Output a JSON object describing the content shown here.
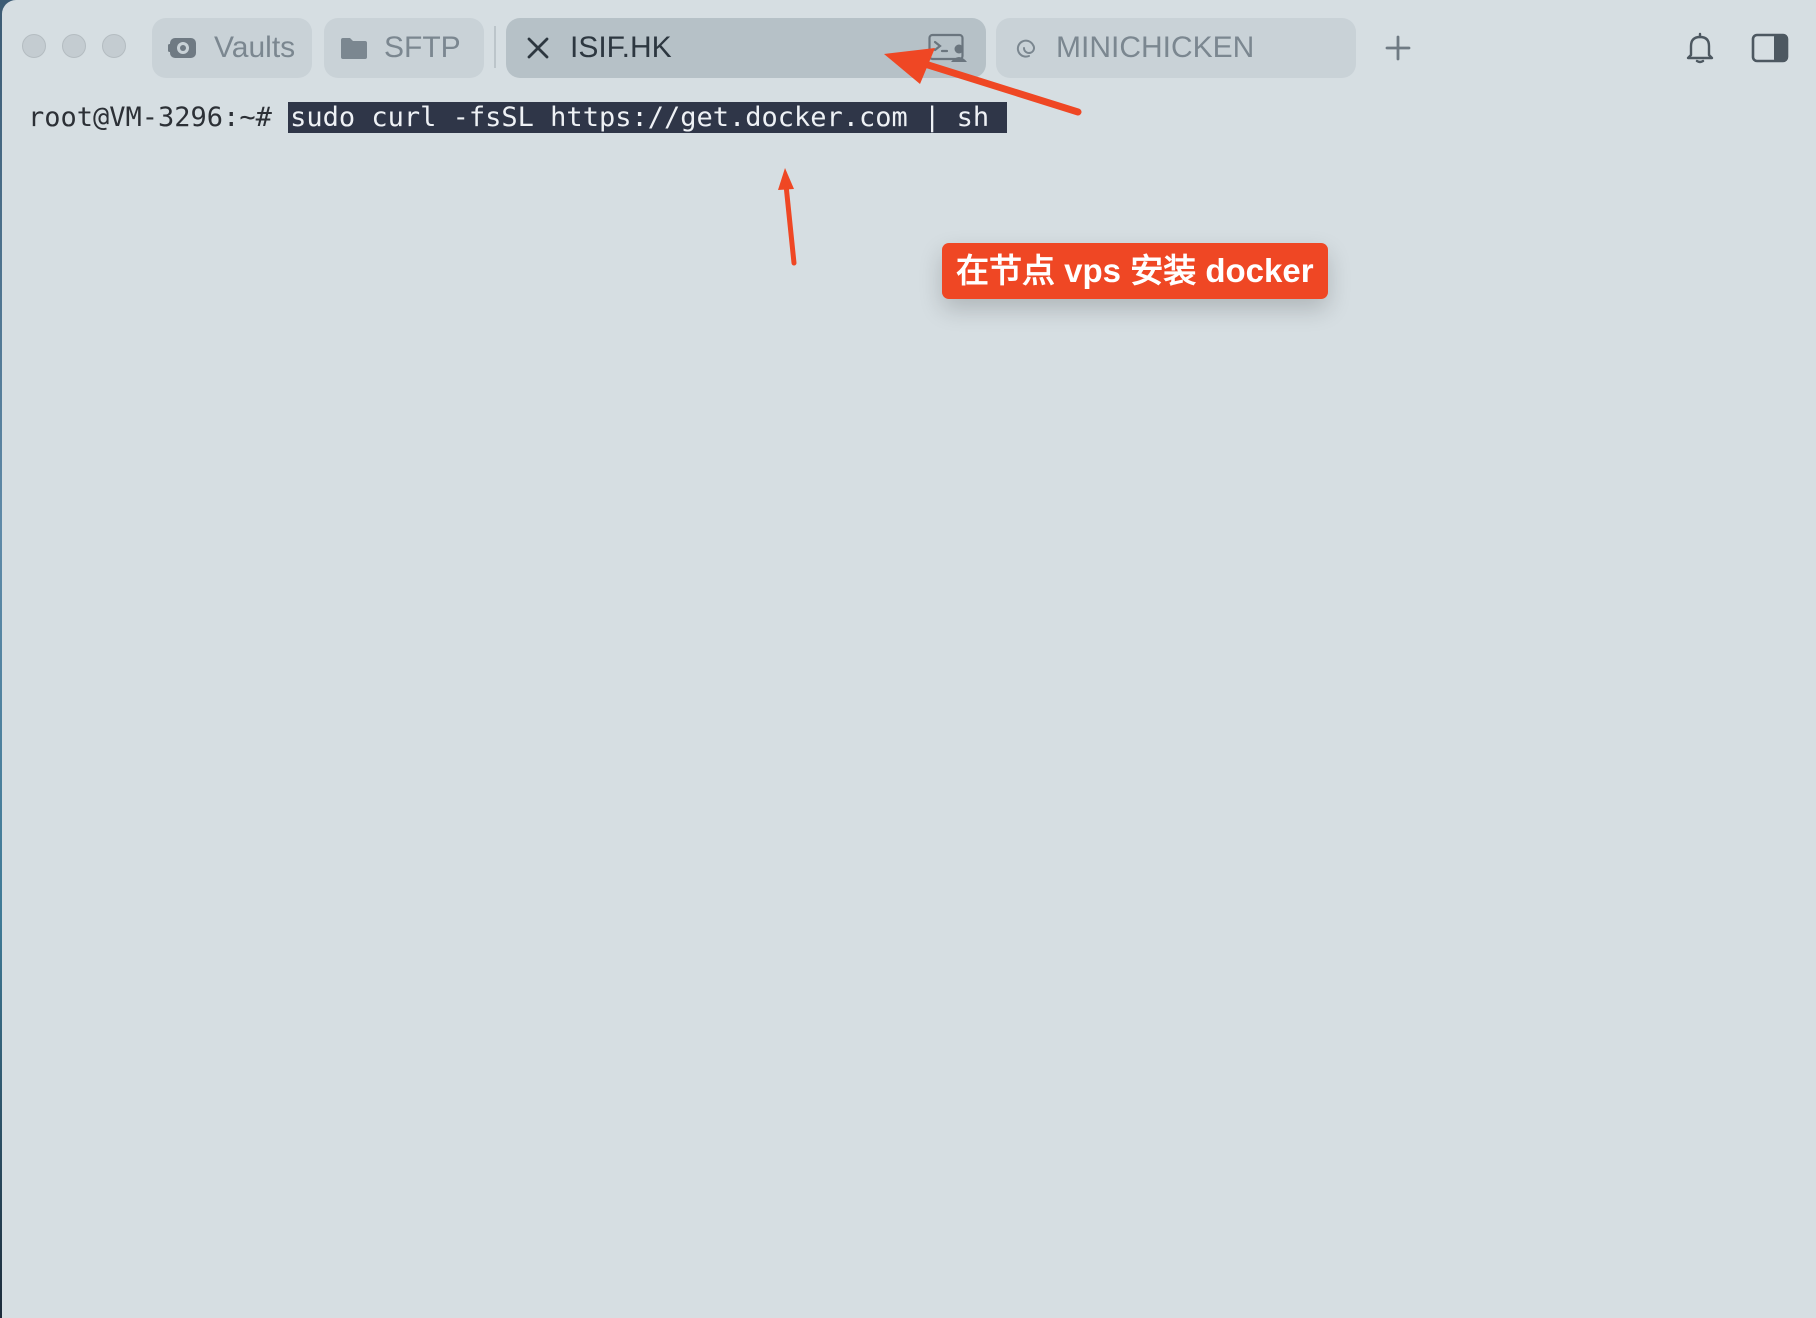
{
  "tabs": [
    {
      "label": "Vaults",
      "icon": "vault-icon"
    },
    {
      "label": "SFTP",
      "icon": "folder-icon"
    },
    {
      "label": "ISIF.HK",
      "icon": "close-icon",
      "active": true,
      "trailing_icon": "terminal-person-icon"
    },
    {
      "label": "MINICHICKEN",
      "icon": "debian-swirl-icon"
    }
  ],
  "toolbar": {
    "new_tab_icon": "plus-icon",
    "notifications_icon": "bell-icon",
    "sidebar_toggle_icon": "sidebar-icon"
  },
  "terminal": {
    "prompt": "root@VM-3296:~# ",
    "command": "sudo curl -fsSL https://get.docker.com | sh "
  },
  "annotation": {
    "text": "在节点 vps 安装 docker",
    "color": "#ef4724"
  },
  "colors": {
    "window_bg": "#d6dee2",
    "selection_bg": "#2f3648",
    "accent": "#ef4724"
  }
}
